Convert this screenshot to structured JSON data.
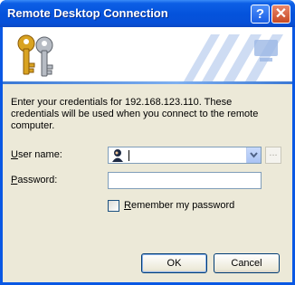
{
  "window": {
    "title": "Remote Desktop Connection"
  },
  "titlebar": {
    "help_label": "?",
    "close_label": "✕"
  },
  "intro": {
    "line1": "Enter your credentials for 192.168.123.110. These",
    "line2": "credentials will be used when you connect to the remote",
    "line3": "computer."
  },
  "form": {
    "username_label_key": "U",
    "username_label_rest": "ser name:",
    "username_value": "",
    "password_label_key": "P",
    "password_label_rest": "assword:",
    "password_value": "",
    "browse_label": "...",
    "remember_label_key": "R",
    "remember_label_rest": "emember my password",
    "remember_checked": false
  },
  "buttons": {
    "ok_label": "OK",
    "cancel_label": "Cancel"
  },
  "colors": {
    "titlebar": "#0453dc",
    "dialog_bg": "#ece9d8",
    "input_border": "#7f9db9"
  }
}
